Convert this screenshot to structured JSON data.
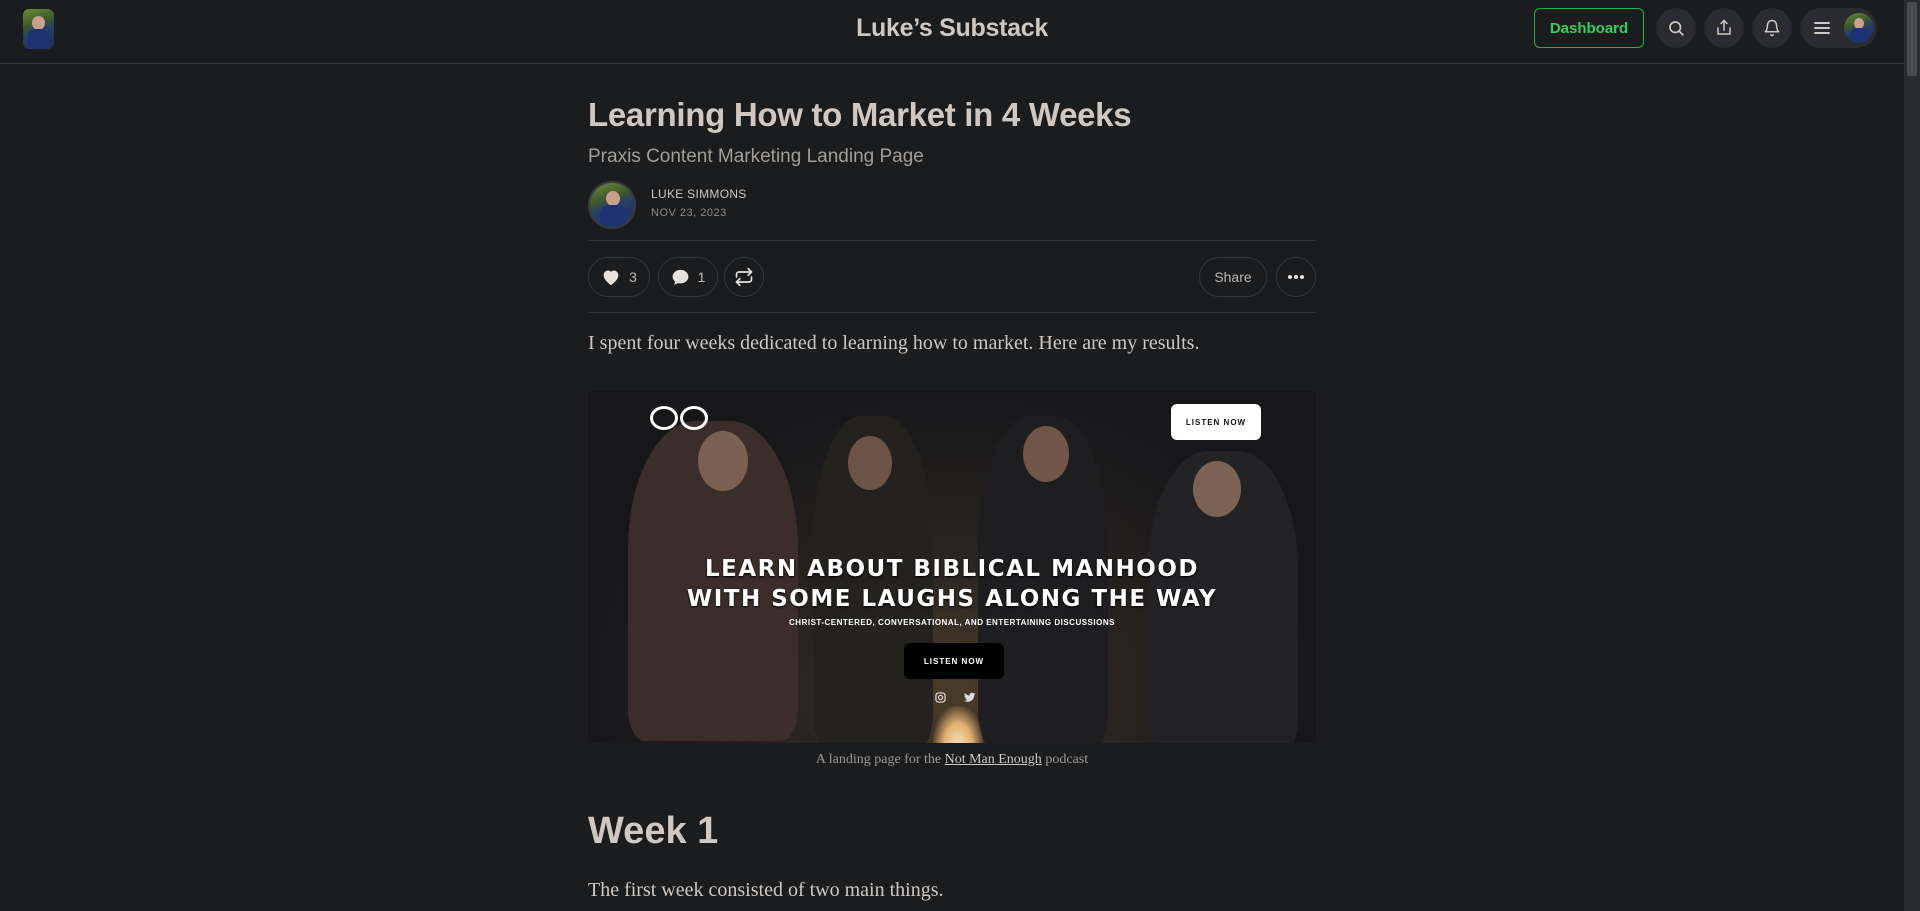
{
  "header": {
    "publication_title": "Luke’s Substack",
    "dashboard_label": "Dashboard",
    "accent_color": "#2fd15c"
  },
  "article": {
    "title": "Learning How to Market in 4 Weeks",
    "subtitle": "Praxis Content Marketing Landing Page",
    "author": "LUKE SIMMONS",
    "date": "NOV 23, 2023",
    "likes": "3",
    "comments": "1",
    "share_label": "Share",
    "intro": "I spent four weeks dedicated to learning how to market. Here are my results.",
    "image": {
      "top_button": "LISTEN NOW",
      "headline_line1": "LEARN ABOUT BIBLICAL MANHOOD",
      "headline_line2": "WITH SOME LAUGHS ALONG THE WAY",
      "subline": "CHRIST-CENTERED, CONVERSATIONAL, AND ENTERTAINING DISCUSSIONS",
      "cta_button": "LISTEN NOW"
    },
    "caption_prefix": "A landing page for the ",
    "caption_link": "Not Man Enough",
    "caption_suffix": " podcast",
    "section_heading": "Week 1",
    "section_text": "The first week consisted of two main things."
  },
  "icons": {
    "search": "search-icon",
    "share": "share-icon",
    "notifications": "bell-icon",
    "menu": "hamburger-icon",
    "like": "heart-icon",
    "comment": "comment-icon",
    "restack": "restack-icon",
    "more": "ellipsis-icon"
  }
}
